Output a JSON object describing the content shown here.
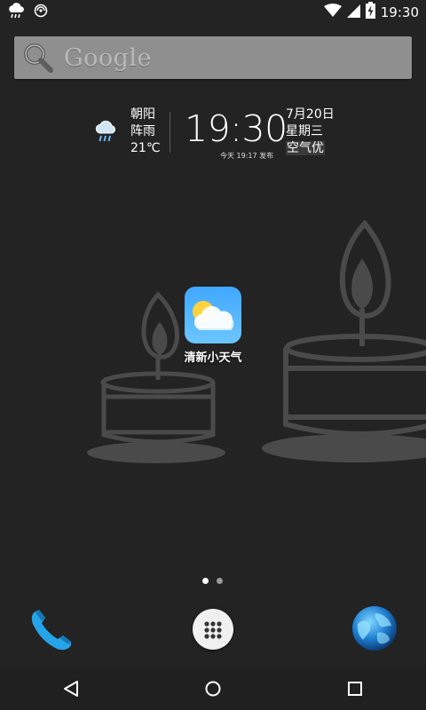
{
  "status_bar": {
    "time": "19:30",
    "icons_left": [
      "weather-rain-icon",
      "notification-icon"
    ],
    "icons_right": [
      "wifi-icon",
      "signal-icon",
      "battery-charging-icon"
    ]
  },
  "search": {
    "brand_text": "Google"
  },
  "weather_widget": {
    "location": "朝阳",
    "condition": "阵雨",
    "temperature": "21℃",
    "time": "19:30",
    "published": "今天 19:17 发布",
    "date": "7月20日",
    "weekday": "星期三",
    "air_quality": "空气优"
  },
  "home_app": {
    "label": "清新小天气",
    "icon": "weather-app-icon"
  },
  "pager": {
    "active_color": "#ffffff",
    "inactive_color": "#9a9a9a"
  },
  "dock": {
    "left": "phone-icon",
    "center": "app-drawer-icon",
    "right": "browser-icon"
  },
  "nav": {
    "back": "back-icon",
    "home": "home-icon",
    "recents": "recents-icon"
  }
}
